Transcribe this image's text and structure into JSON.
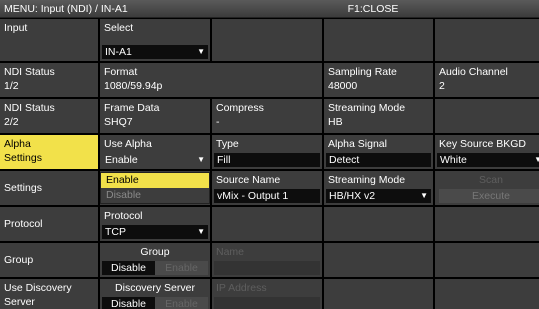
{
  "header": {
    "menu_path": "MENU: Input (NDI) / IN-A1",
    "close_hint": "F1:CLOSE"
  },
  "rows": {
    "input": {
      "label": "Input",
      "select_label": "Select",
      "select_value": "IN-A1"
    },
    "ndi_status_1": {
      "label_line1": "NDI Status",
      "label_line2": "1/2",
      "format_label": "Format",
      "format_value": "1080/59.94p",
      "sampling_label": "Sampling Rate",
      "sampling_value": "48000",
      "audio_label": "Audio Channel",
      "audio_value": "2"
    },
    "ndi_status_2": {
      "label_line1": "NDI Status",
      "label_line2": "2/2",
      "frame_label": "Frame Data",
      "frame_value": "SHQ7",
      "compress_label": "Compress",
      "compress_value": "-",
      "streaming_label": "Streaming Mode",
      "streaming_value": "HB"
    },
    "alpha": {
      "label_line1": "Alpha",
      "label_line2": "Settings",
      "use_alpha_label": "Use Alpha",
      "use_alpha_value": "Enable",
      "type_label": "Type",
      "type_value": "Fill",
      "signal_label": "Alpha Signal",
      "signal_value": "Detect",
      "bkgd_label": "Key Source BKGD",
      "bkgd_value": "White"
    },
    "settings": {
      "label": "Settings",
      "source_label": "Source Name",
      "source_value": "vMix - Output 1",
      "mode_label": "Streaming Mode",
      "mode_value": "HB/HX v2",
      "scan_label": "Scan",
      "execute_label": "Execute"
    },
    "protocol": {
      "label": "Protocol",
      "protocol_label": "Protocol",
      "protocol_value": "TCP"
    },
    "group": {
      "label": "Group",
      "group_label": "Group",
      "disable": "Disable",
      "enable": "Enable",
      "name_label": "Name"
    },
    "discovery": {
      "label_line1": "Use Discovery",
      "label_line2": "Server",
      "server_label": "Discovery Server",
      "disable": "Disable",
      "enable": "Enable",
      "ip_label": "IP Address"
    }
  },
  "dropdown": {
    "options": [
      "Enable",
      "Disable"
    ],
    "selected": "Enable"
  },
  "icons": {
    "dropdown_arrow": "triangle-down-icon"
  },
  "colors": {
    "highlight": "#f2e14a",
    "cell": "#3d3d3d",
    "background": "#000000"
  }
}
